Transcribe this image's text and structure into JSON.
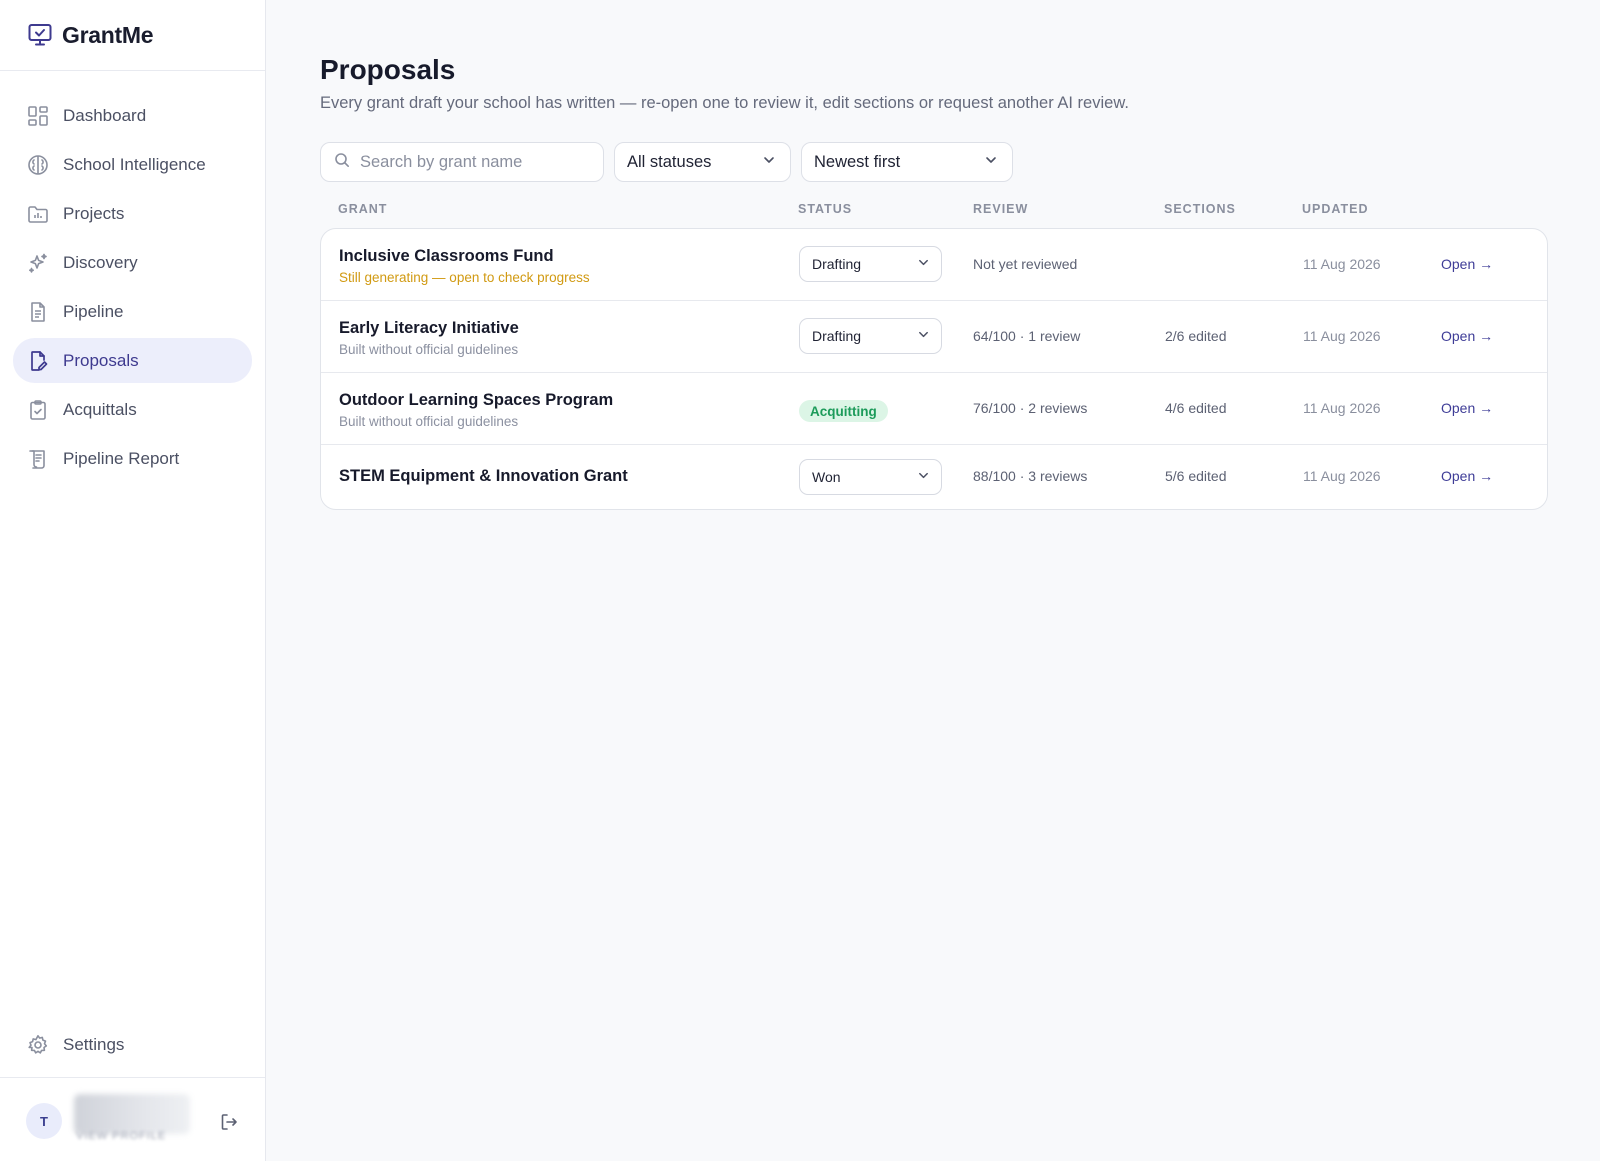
{
  "app": {
    "name": "GrantMe"
  },
  "sidebar": {
    "items": [
      {
        "label": "Dashboard",
        "icon": "dashboard-grid-icon"
      },
      {
        "label": "School Intelligence",
        "icon": "brain-icon"
      },
      {
        "label": "Projects",
        "icon": "folder-chart-icon"
      },
      {
        "label": "Discovery",
        "icon": "sparkles-icon"
      },
      {
        "label": "Pipeline",
        "icon": "document-list-icon"
      },
      {
        "label": "Proposals",
        "icon": "document-pen-icon",
        "active": true
      },
      {
        "label": "Acquittals",
        "icon": "clipboard-check-icon"
      },
      {
        "label": "Pipeline Report",
        "icon": "scroll-icon"
      }
    ],
    "settings": {
      "label": "Settings",
      "icon": "gear-icon"
    },
    "profile": {
      "initial": "T",
      "subtitle": "VIEW PROFILE"
    }
  },
  "page": {
    "title": "Proposals",
    "subtitle": "Every grant draft your school has written — re-open one to review it, edit sections or request another AI review."
  },
  "filters": {
    "search_placeholder": "Search by grant name",
    "status_value": "All statuses",
    "sort_value": "Newest first"
  },
  "table": {
    "columns": [
      "GRANT",
      "STATUS",
      "REVIEW",
      "SECTIONS",
      "UPDATED"
    ],
    "rows": [
      {
        "name": "Inclusive Classrooms Fund",
        "note": "Still generating — open to check progress",
        "status": "Drafting",
        "review": "Not yet reviewed",
        "sections": "",
        "updated": "11 Aug 2026",
        "action": "Open →"
      },
      {
        "name": "Early Literacy Initiative",
        "note": "Built without official guidelines",
        "status": "Drafting",
        "review": "64/100 · 1 review",
        "sections": "2/6 edited",
        "updated": "11 Aug 2026",
        "action": "Open →"
      },
      {
        "name": "Outdoor Learning Spaces Program",
        "note": "Built without official guidelines",
        "status": "Acquitting",
        "review": "76/100 · 2 reviews",
        "sections": "4/6 edited",
        "updated": "11 Aug 2026",
        "action": "Open →"
      },
      {
        "name": "STEM Equipment & Innovation Grant",
        "note": "",
        "status": "Won",
        "review": "88/100 · 3 reviews",
        "sections": "5/6 edited",
        "updated": "11 Aug 2026",
        "action": "Open →"
      }
    ]
  },
  "colors": {
    "accent": "#3e3a8f",
    "active_bg": "#eceefb",
    "warning_text": "#d19a12",
    "success_bg": "#dcf5e6",
    "success_text": "#1c9b5a"
  }
}
